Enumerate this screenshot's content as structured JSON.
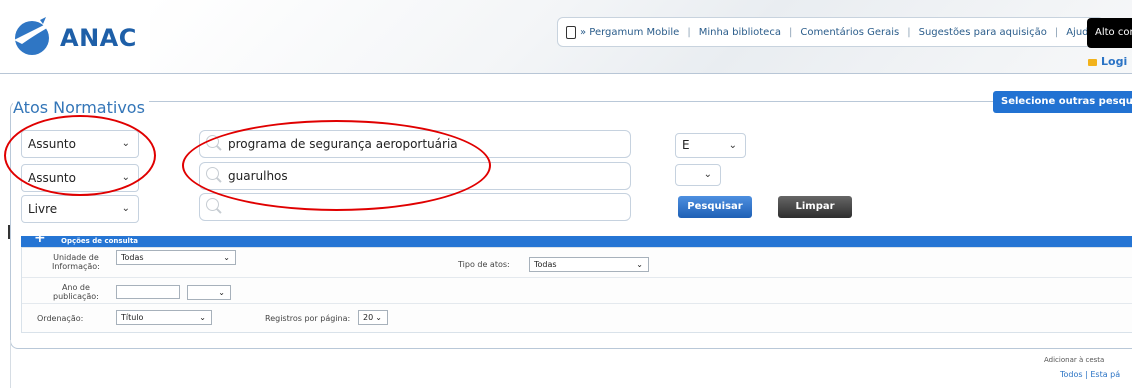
{
  "header": {
    "logo_text": "ANAC",
    "nav": [
      "» Pergamum Mobile",
      "Minha biblioteca",
      "Comentários Gerais",
      "Sugestões para aquisição",
      "Ajuda"
    ],
    "contrast_label": "Alto cont",
    "login_label": "Logi"
  },
  "panel": {
    "title": "Atos Normativos",
    "select_other": "Selecione outras pesquis"
  },
  "search": {
    "rows": [
      {
        "field": "Assunto",
        "term": "programa de segurança aeroportuária",
        "operator": "E"
      },
      {
        "field": "Assunto",
        "term": "guarulhos",
        "operator": ""
      },
      {
        "field": "Livre",
        "term": ""
      }
    ],
    "btn_search": "Pesquisar",
    "btn_clear": "Limpar"
  },
  "options": {
    "header": "Opções de consulta",
    "unidade_label_1": "Unidade de",
    "unidade_label_2": "Informação:",
    "unidade_value": "Todas",
    "tipo_label": "Tipo de atos:",
    "tipo_value": "Todas",
    "ano_label_1": "Ano de",
    "ano_label_2": "publicação:",
    "ano_value": "",
    "ordenacao_label": "Ordenação:",
    "ordenacao_value": "Título",
    "registros_label": "Registros por página:",
    "registros_value": "20"
  },
  "cesta": {
    "label": "Adicionar à cesta",
    "todos": "Todos",
    "esta": "Esta pá"
  },
  "colors": {
    "accent": "#2575d4",
    "highlight": "#e00000"
  }
}
